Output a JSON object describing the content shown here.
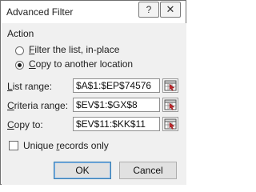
{
  "window": {
    "title": "Advanced Filter",
    "help_glyph": "?",
    "close_glyph": "✕"
  },
  "action": {
    "group_label": "Action",
    "options": [
      {
        "label": "Filter the list, in-place",
        "selected": false
      },
      {
        "label": "Copy to another location",
        "selected": true
      }
    ]
  },
  "fields": {
    "list_range": {
      "label": "List range:",
      "value": "$A$1:$EP$74576"
    },
    "criteria_range": {
      "label": "Criteria range:",
      "value": "$EV$1:$GX$8"
    },
    "copy_to": {
      "label": "Copy to:",
      "value": "$EV$11:$KK$11"
    }
  },
  "unique_records": {
    "label": "Unique records only",
    "checked": false
  },
  "buttons": {
    "ok": "OK",
    "cancel": "Cancel"
  },
  "icons": {
    "help": "help-icon",
    "close": "close-icon",
    "range_selector": "collapse-dialog-range-icon"
  }
}
